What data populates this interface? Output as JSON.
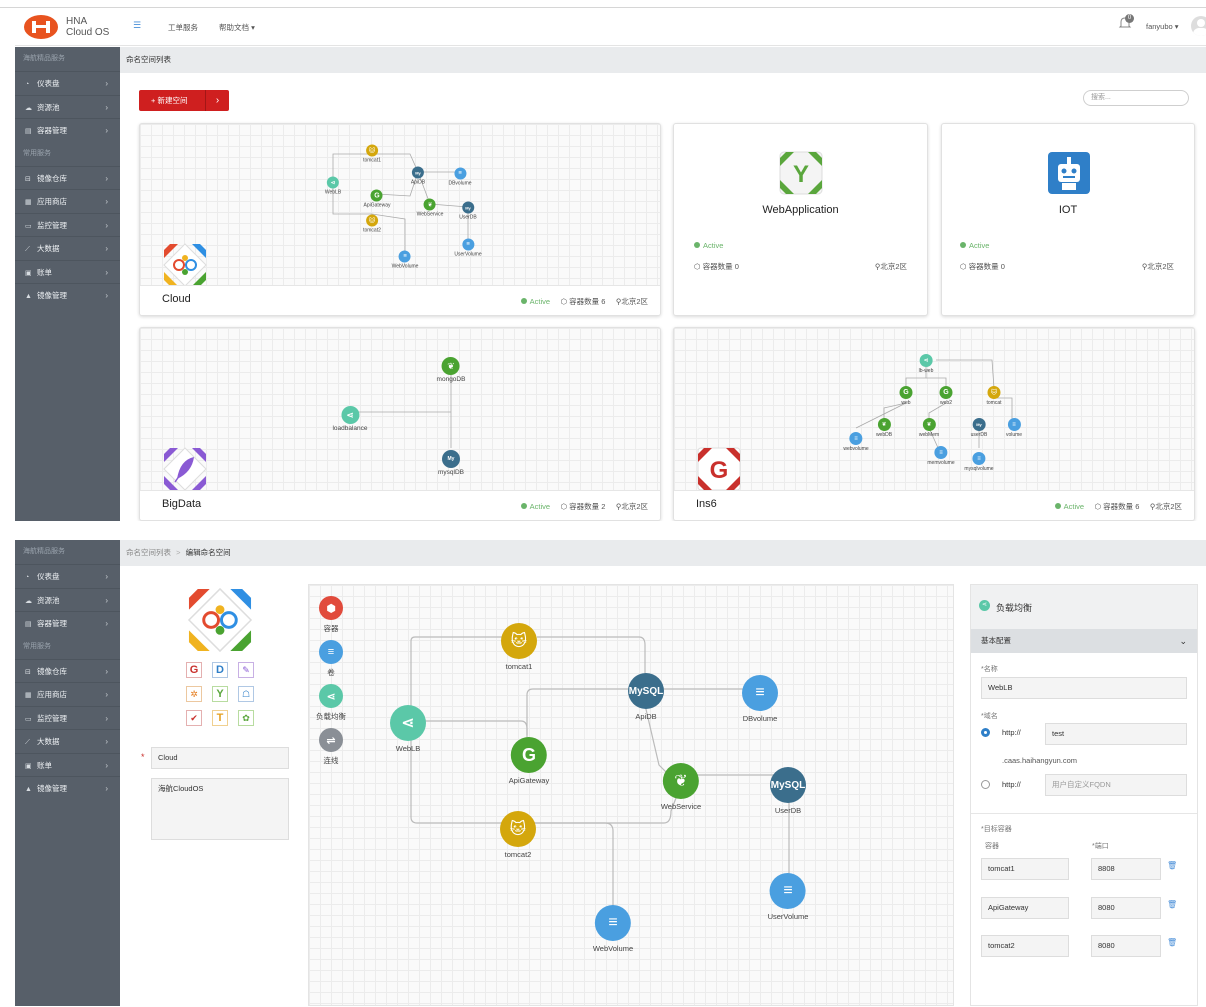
{
  "brand": {
    "line1": "HNA",
    "line2": "Cloud OS"
  },
  "header": {
    "menu_icon": "menu-icon",
    "nav": [
      "工单服务",
      "帮助文档"
    ],
    "notif_count": "0",
    "user": "fanyubo"
  },
  "sidebar": {
    "group1": "海航精品服务",
    "items1": [
      {
        "label": "仪表盘",
        "icon": "dashboard-icon"
      },
      {
        "label": "资源池",
        "icon": "cloud-icon"
      },
      {
        "label": "容器管理",
        "icon": "container-icon"
      }
    ],
    "group2": "常用服务",
    "items2": [
      {
        "label": "镜像仓库",
        "icon": "repo-icon"
      },
      {
        "label": "应用商店",
        "icon": "store-icon"
      },
      {
        "label": "监控管理",
        "icon": "monitor-icon"
      },
      {
        "label": "大数据",
        "icon": "chart-icon"
      },
      {
        "label": "账单",
        "icon": "bill-icon"
      },
      {
        "label": "镜像管理",
        "icon": "image-icon"
      }
    ]
  },
  "list": {
    "breadcrumb": "命名空间列表",
    "new_button": "+ 新建空间",
    "search_placeholder": "搜索...",
    "cards": [
      {
        "name": "Cloud",
        "status": "Active",
        "containers": "容器数量 6",
        "region": "北京2区"
      },
      {
        "name": "WebApplication",
        "status": "Active",
        "containers": "容器数量 0",
        "region": "北京2区"
      },
      {
        "name": "IOT",
        "status": "Active",
        "containers": "容器数量 0",
        "region": "北京2区"
      },
      {
        "name": "BigData",
        "status": "Active",
        "containers": "容器数量 2",
        "region": "北京2区"
      },
      {
        "name": "Ins6",
        "status": "Active",
        "containers": "容器数量 6",
        "region": "北京2区"
      }
    ],
    "cloud_nodes": [
      "tomcat1",
      "WebLB",
      "ApiDB",
      "DBvolume",
      "ApiGateway",
      "WebService",
      "UserDB",
      "tomcat2",
      "UserVolume",
      "WebVolume"
    ],
    "bigdata_nodes": [
      "mongoDB",
      "loadbalance",
      "mysqlDB"
    ],
    "ins6_nodes": [
      "lb-web",
      "web",
      "web2",
      "tomcat",
      "webDB",
      "webMem",
      "userDB",
      "volume",
      "webvolume",
      "memvolume",
      "mysqlvolume"
    ]
  },
  "edit": {
    "breadcrumb_parent": "命名空间列表",
    "breadcrumb_sep": ">",
    "breadcrumb_current": "编辑命名空间",
    "icon_letters": [
      "G",
      "D",
      "T"
    ],
    "name_value": "Cloud",
    "required_mark": "*",
    "desc_value": "海航CloudOS",
    "palette": [
      "容器",
      "卷",
      "负载均衡",
      "连线"
    ],
    "nodes": [
      "tomcat1",
      "WebLB",
      "ApiDB",
      "DBvolume",
      "ApiGateway",
      "WebService",
      "UserDB",
      "tomcat2",
      "UserVolume",
      "WebVolume"
    ],
    "panel": {
      "title": "负载均衡",
      "section": "基本配置",
      "name_label": "*名称",
      "name_value": "WebLB",
      "domain_label": "*域名",
      "proto1": "http://",
      "domain_value": "test",
      "suffix": ".caas.haihangyun.com",
      "proto2": "http://",
      "fqdn_placeholder": "用户自定义FQDN",
      "target_label": "*目标容器",
      "col_container": "容器",
      "col_port": "*端口",
      "targets": [
        {
          "container": "tomcat1",
          "port": "8808"
        },
        {
          "container": "ApiGateway",
          "port": "8080"
        },
        {
          "container": "tomcat2",
          "port": "8080"
        }
      ]
    }
  },
  "colors": {
    "sidebar": "#575f69",
    "accent_red": "#cf1f1f",
    "lb": "#5bc8a8",
    "gateway": "#4aa331",
    "tomcat": "#d4a70c",
    "mysql": "#3b6e8c",
    "volume": "#4a9fe0",
    "mongo": "#4aa331",
    "active": "#6ab46a"
  }
}
